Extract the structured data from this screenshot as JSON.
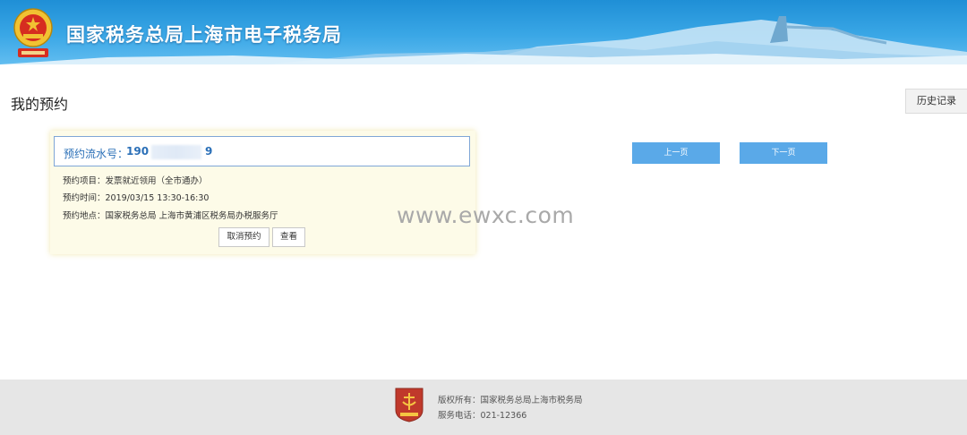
{
  "header": {
    "title": "国家税务总局上海市电子税务局",
    "emblem_icon": "tax-emblem-icon"
  },
  "main": {
    "page_title": "我的预约",
    "history_button": "历史记录",
    "prev_button": "上一页",
    "next_button": "下一页"
  },
  "appointment": {
    "serial_label": "预约流水号：",
    "serial_prefix": "190",
    "serial_suffix": "9",
    "item_label": "预约项目：",
    "item_value": "发票就近领用（全市通办）",
    "time_label": "预约时间：",
    "time_value": "2019/03/15  13:30-16:30",
    "place_label": "预约地点：",
    "place_value": "国家税务总局 上海市黄浦区税务局办税服务厅",
    "cancel_button": "取消预约",
    "view_button": "查看"
  },
  "watermark": "www.ewxc.com",
  "footer": {
    "copyright": "版权所有：国家税务总局上海市税务局",
    "phone": "服务电话：021-12366",
    "logo_icon": "tax-service-logo-icon"
  },
  "colors": {
    "header_blue": "#2b9be0",
    "pager_blue": "#5aa9e8",
    "card_bg": "#fdfbe8",
    "serial_text": "#2a6fb7",
    "footer_bg": "#e6e6e6"
  }
}
